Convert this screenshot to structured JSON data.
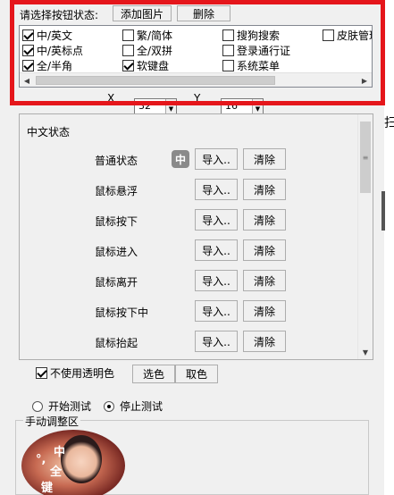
{
  "toolbar": {
    "label": "请选择按钮状态:",
    "add_image": "添加图片",
    "delete": "删除"
  },
  "checklist": {
    "items": [
      {
        "label": "中/英文",
        "checked": true
      },
      {
        "label": "繁/简体",
        "checked": false
      },
      {
        "label": "搜狗搜索",
        "checked": false
      },
      {
        "label": "皮肤管理",
        "checked": false
      },
      {
        "label": "中/英标点",
        "checked": true
      },
      {
        "label": "全/双拼",
        "checked": false
      },
      {
        "label": "登录通行证",
        "checked": false
      },
      {
        "label": "全/半角",
        "checked": true
      },
      {
        "label": "软键盘",
        "checked": true
      },
      {
        "label": "系统菜单",
        "checked": false
      }
    ]
  },
  "side_text": "扫",
  "coords": {
    "x_label": "X",
    "x_value": "32",
    "y_label": "Y",
    "y_value": "16"
  },
  "states": {
    "title": "中文状态",
    "import_label": "导入..",
    "clear_label": "清除",
    "icon_char": "中",
    "rows": [
      {
        "label": "普通状态",
        "has_icon": true
      },
      {
        "label": "鼠标悬浮",
        "has_icon": false
      },
      {
        "label": "鼠标按下",
        "has_icon": false
      },
      {
        "label": "鼠标进入",
        "has_icon": false
      },
      {
        "label": "鼠标离开",
        "has_icon": false
      },
      {
        "label": "鼠标按下中",
        "has_icon": false
      },
      {
        "label": "鼠标抬起",
        "has_icon": false
      }
    ]
  },
  "transparency": {
    "label": "不使用透明色",
    "checked": true,
    "pick_color": "选色",
    "take_color": "取色"
  },
  "test": {
    "start_label": "开始测试",
    "stop_label": "停止测试",
    "selected": "stop"
  },
  "manual": {
    "title": "手动调整区",
    "preview_chars": [
      "中",
      "°,",
      "全",
      "键"
    ]
  },
  "colors": {
    "highlight": "#e5161b",
    "panel_bg": "#f0f0f0"
  }
}
